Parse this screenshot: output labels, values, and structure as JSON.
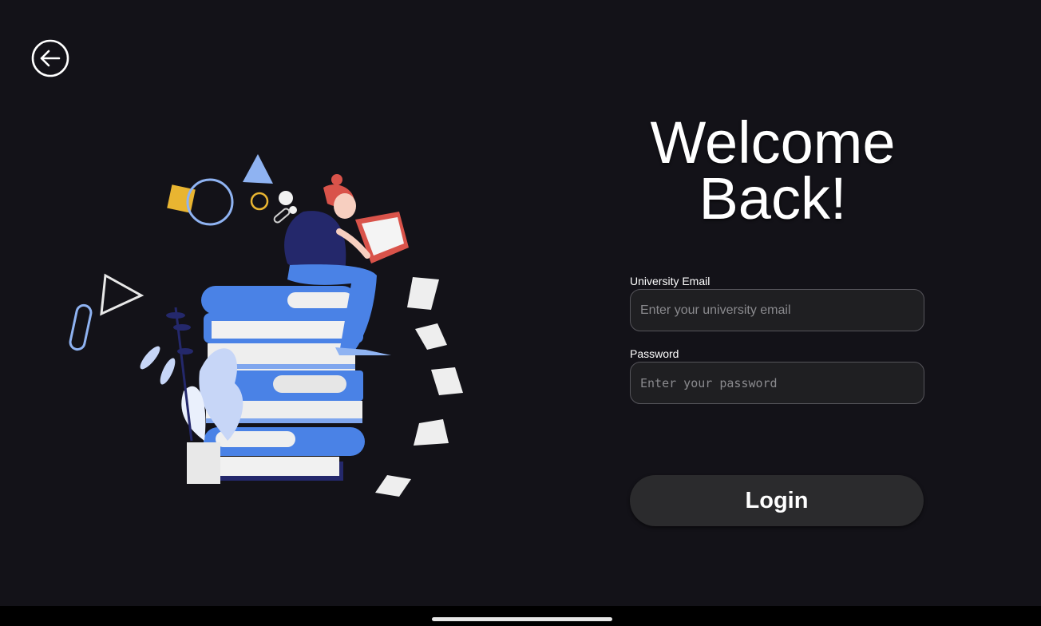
{
  "header": {
    "back_icon": "arrow-left-circle-icon"
  },
  "welcome": {
    "line1": "Welcome",
    "line2": "Back!"
  },
  "form": {
    "email_label": "University Email",
    "email_placeholder": "Enter your university email",
    "email_value": "",
    "password_label": "Password",
    "password_placeholder": "Enter your password",
    "password_value": "",
    "login_label": "Login"
  },
  "illustration": {
    "subject": "woman-reading-on-books-illustration"
  },
  "colors": {
    "background": "#131218",
    "input_background": "#1f1f22",
    "input_border": "#55545a",
    "button_background": "#2b2b2d",
    "text": "#ffffff",
    "placeholder": "#8a8a8e",
    "accent_blue": "#4f86e8",
    "accent_yellow": "#e9b531",
    "accent_red": "#d9534a",
    "accent_navy": "#24286b"
  }
}
